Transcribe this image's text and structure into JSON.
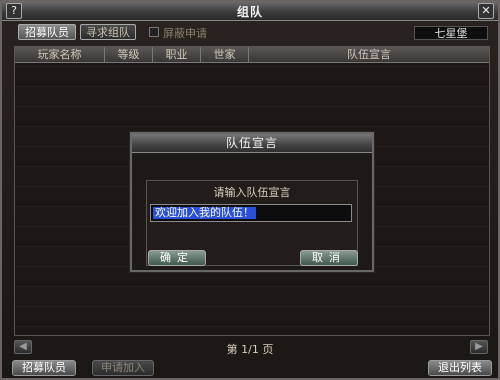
{
  "window": {
    "title": "组队"
  },
  "tabs": [
    {
      "label": "招募队员",
      "active": true
    },
    {
      "label": "寻求组队",
      "active": false
    }
  ],
  "filter": {
    "label": "屏蔽申请",
    "checked": false
  },
  "guild_name": "七星堡",
  "table": {
    "columns": [
      "玩家名称",
      "等级",
      "职业",
      "世家",
      "队伍宣言"
    ],
    "rows": []
  },
  "pager": {
    "text": "第 1/1 页",
    "prev_icon": "arrow-left-icon",
    "next_icon": "arrow-right-icon"
  },
  "buttons": {
    "recruit": "招募队员",
    "apply": "申请加入",
    "exit": "退出列表"
  },
  "dialog": {
    "title": "队伍宣言",
    "prompt": "请输入队伍宣言",
    "input_value": "欢迎加入我的队伍！",
    "confirm": "确定",
    "cancel": "取消"
  },
  "colors": {
    "input_highlight": "#2a4fd8",
    "background": "#1d1816"
  }
}
